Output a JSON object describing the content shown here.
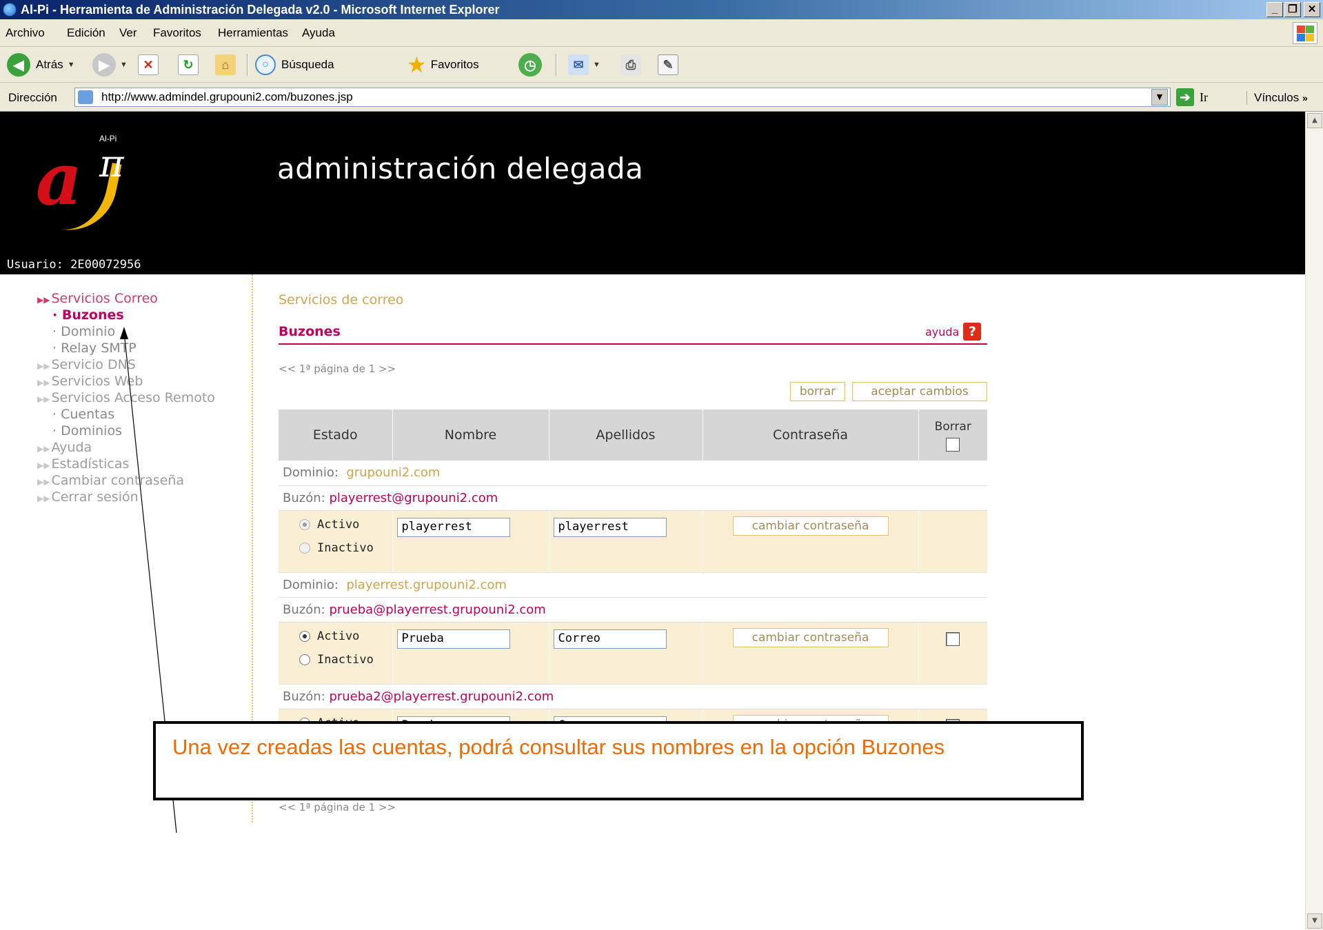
{
  "window": {
    "title": "Al-Pi - Herramienta de Administración Delegada v2.0 - Microsoft Internet Explorer"
  },
  "menu": [
    "Archivo",
    "Edición",
    "Ver",
    "Favoritos",
    "Herramientas",
    "Ayuda"
  ],
  "toolbar": {
    "back": "Atrás",
    "search": "Búsqueda",
    "favorites": "Favoritos"
  },
  "address": {
    "label": "Dirección",
    "url": "http://www.admindel.grupouni2.com/buzones.jsp",
    "go": "Ir",
    "links": "Vínculos"
  },
  "header": {
    "logo_text": "Al-Pi",
    "title": "administración delegada",
    "user": "Usuario: 2E00072956"
  },
  "sidebar": [
    {
      "label": "Servicios Correo",
      "type": "section",
      "active": true
    },
    {
      "label": "Buzones",
      "type": "sub",
      "active": true
    },
    {
      "label": "Dominio",
      "type": "sub"
    },
    {
      "label": "Relay SMTP",
      "type": "sub"
    },
    {
      "label": "Servicio DNS",
      "type": "section"
    },
    {
      "label": "Servicios Web",
      "type": "section"
    },
    {
      "label": "Servicios Acceso Remoto",
      "type": "section"
    },
    {
      "label": "Cuentas",
      "type": "sub"
    },
    {
      "label": "Dominios",
      "type": "sub"
    },
    {
      "label": "Ayuda",
      "type": "section"
    },
    {
      "label": "Estadísticas",
      "type": "section"
    },
    {
      "label": "Cambiar contraseña",
      "type": "section"
    },
    {
      "label": "Cerrar sesión",
      "type": "section"
    }
  ],
  "main": {
    "breadcrumb": "Servicios de correo",
    "title": "Buzones",
    "help": "ayuda",
    "pager": "<< 1ª página de 1 >>",
    "delete_btn": "borrar",
    "accept_btn": "aceptar cambios",
    "columns": [
      "Estado",
      "Nombre",
      "Apellidos",
      "Contraseña",
      "Borrar"
    ],
    "domain_label": "Dominio:",
    "mailbox_label": "Buzón:",
    "active_label": "Activo",
    "inactive_label": "Inactivo",
    "change_pwd": "cambiar contraseña",
    "domains": [
      {
        "name": "grupouni2.com",
        "mailboxes": [
          {
            "address": "playerrest@grupouni2.com",
            "nombre": "playerrest",
            "apellidos": "playerrest",
            "status": "Activo",
            "deletable": false
          }
        ]
      },
      {
        "name": "playerrest.grupouni2.com",
        "mailboxes": [
          {
            "address": "prueba@playerrest.grupouni2.com",
            "nombre": "Prueba",
            "apellidos": "Correo",
            "status": "Activo",
            "deletable": true
          },
          {
            "address": "prueba2@playerrest.grupouni2.com",
            "nombre": "Prueba",
            "apellidos": "Correo",
            "status": "Activo",
            "deletable": true
          }
        ]
      }
    ]
  },
  "annotation": {
    "text": "Una vez creadas las cuentas, podrá consultar sus nombres en la opción Buzones"
  },
  "colors": {
    "accent": "#c0005a",
    "gold": "#d2a34a",
    "row_bg": "#faefd5",
    "annotation": "#f06a00"
  }
}
